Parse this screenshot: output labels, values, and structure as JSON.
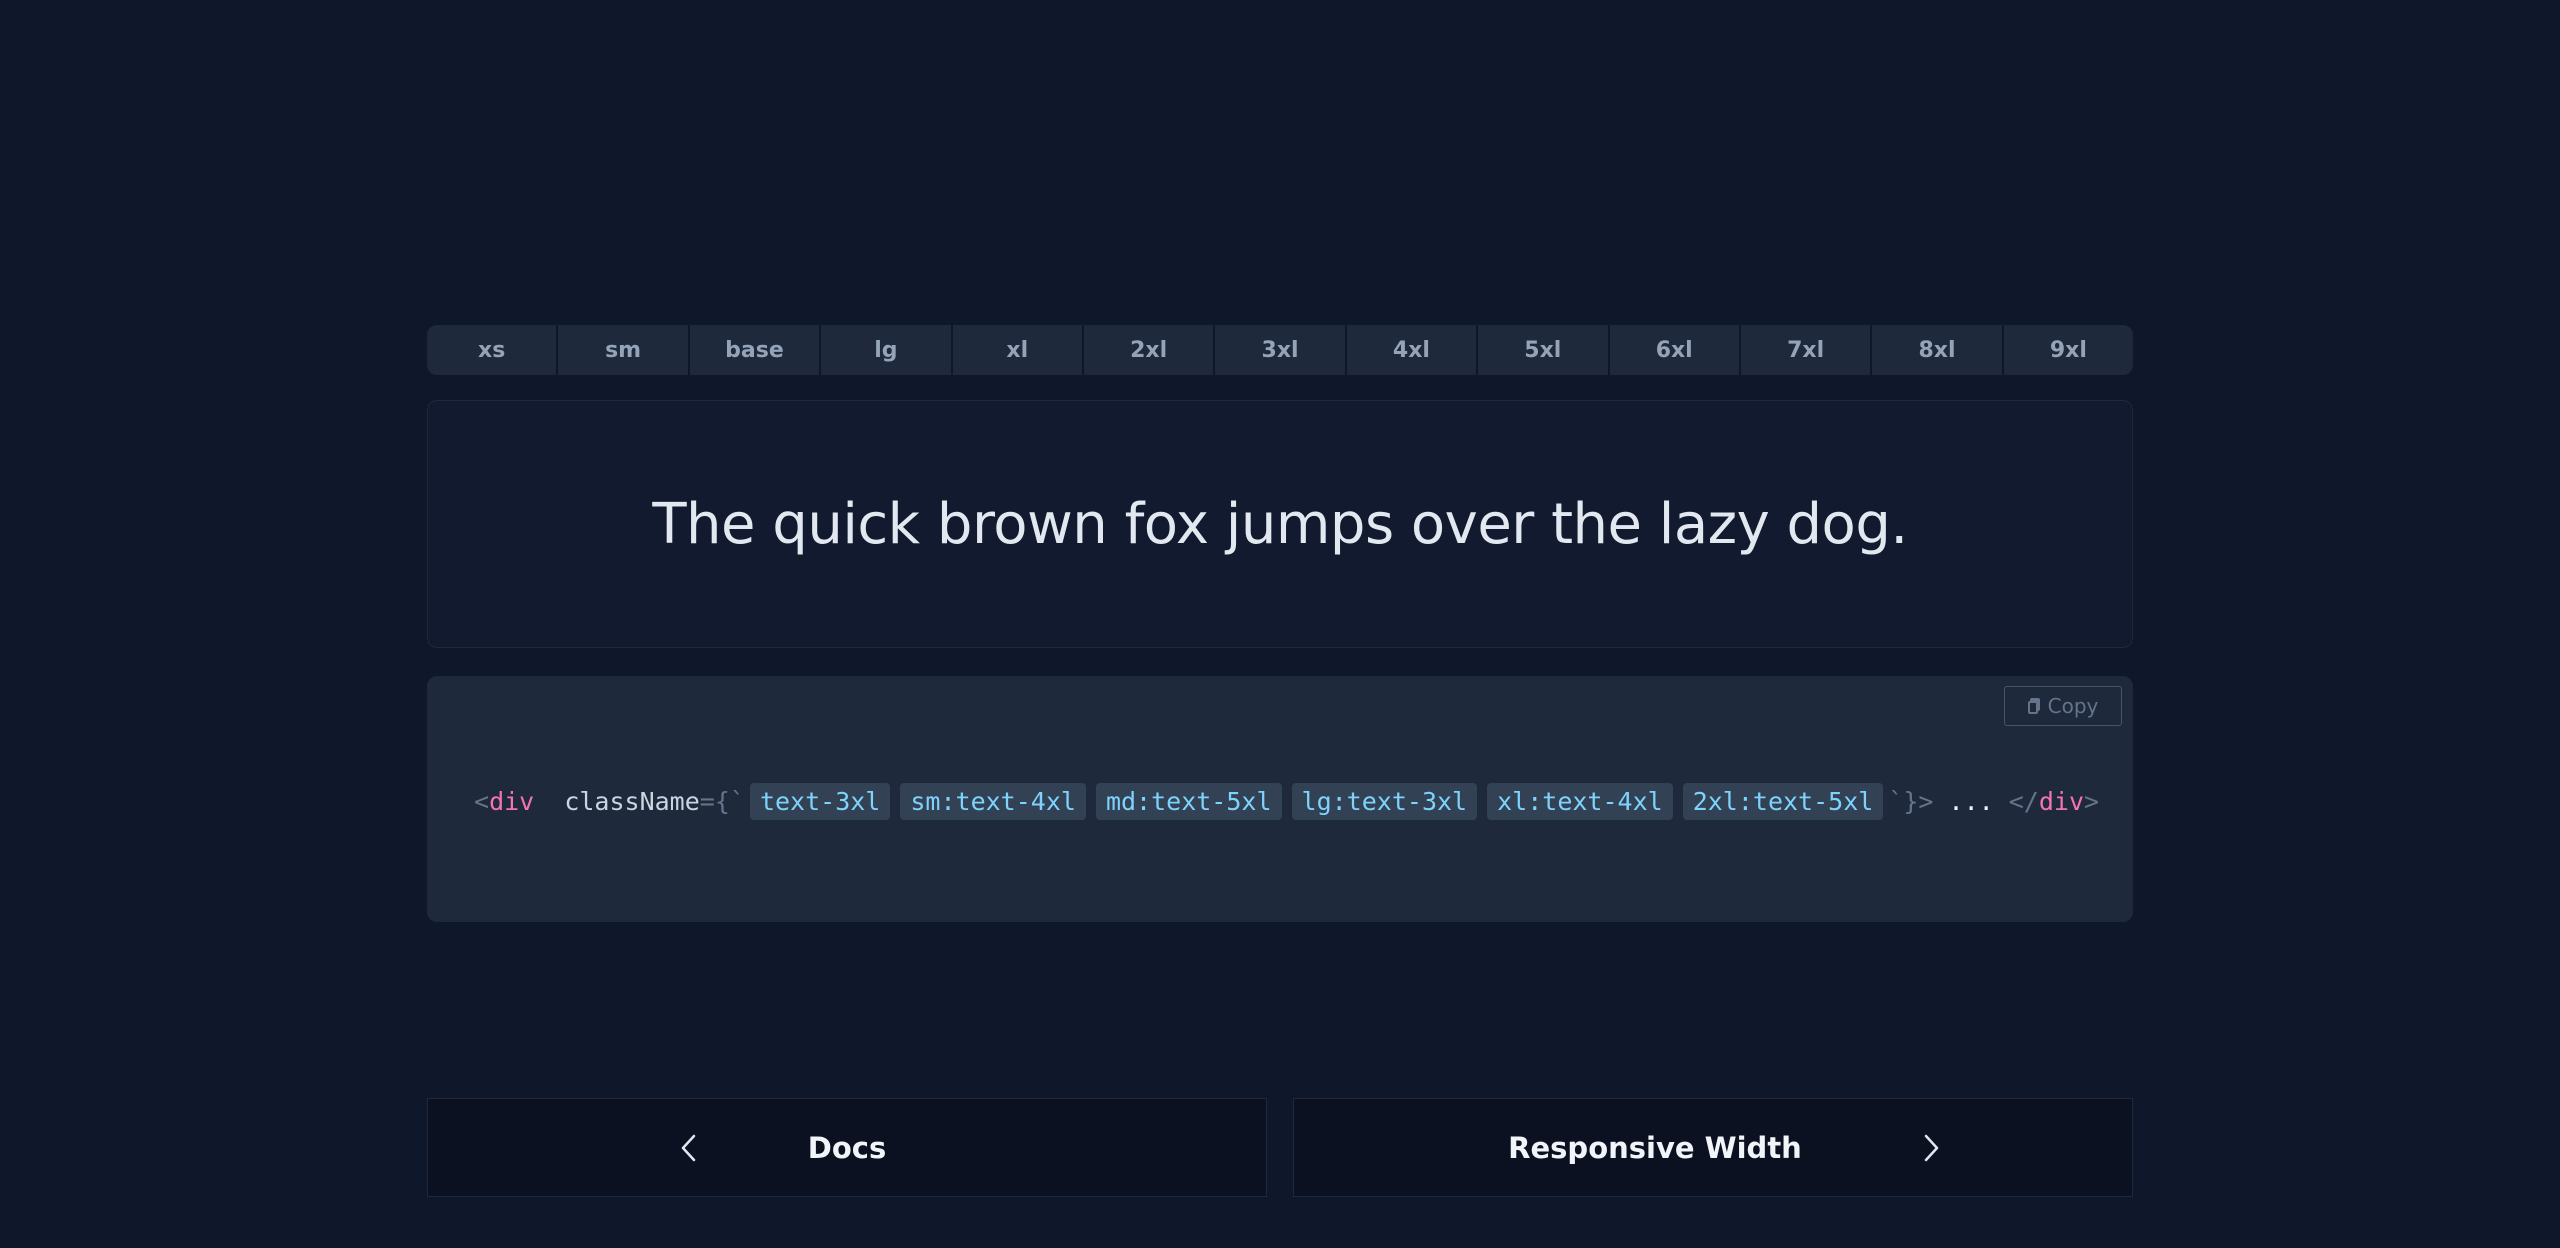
{
  "size_tabs": [
    "xs",
    "sm",
    "base",
    "lg",
    "xl",
    "2xl",
    "3xl",
    "4xl",
    "5xl",
    "6xl",
    "7xl",
    "8xl",
    "9xl"
  ],
  "preview": {
    "text": "The quick brown fox jumps over the lazy dog."
  },
  "code": {
    "copy_label": "Copy",
    "open_bracket": "<",
    "tag": "div",
    "attr": "className",
    "eq_open": "={`",
    "classes": [
      "text-3xl",
      "sm:text-4xl",
      "md:text-5xl",
      "lg:text-3xl",
      "xl:text-4xl",
      "2xl:text-5xl"
    ],
    "close_attr": "`}>",
    "ellipsis": "...",
    "close_open": "</",
    "close_bracket": ">"
  },
  "nav": {
    "prev_label": "Docs",
    "next_label": "Responsive Width"
  }
}
